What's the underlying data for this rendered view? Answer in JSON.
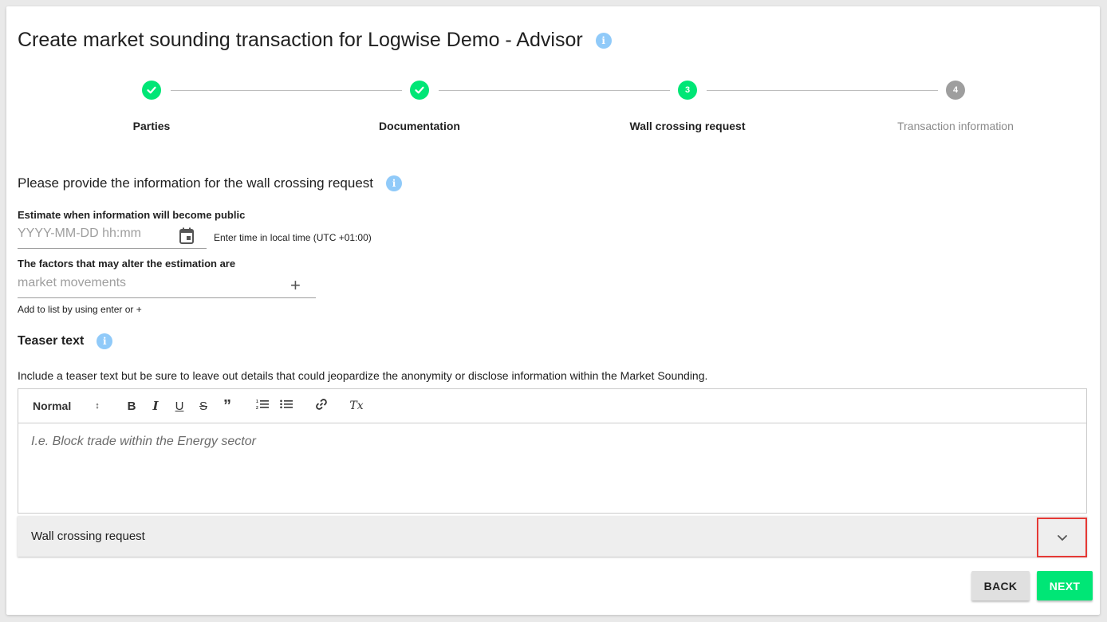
{
  "header": {
    "title": "Create market sounding transaction for Logwise Demo - Advisor",
    "info_icon": "info-icon"
  },
  "stepper": {
    "steps": [
      {
        "index": "1",
        "label": "Parties",
        "state": "done"
      },
      {
        "index": "2",
        "label": "Documentation",
        "state": "done"
      },
      {
        "index": "3",
        "label": "Wall crossing request",
        "state": "active"
      },
      {
        "index": "4",
        "label": "Transaction information",
        "state": "todo"
      }
    ]
  },
  "form": {
    "section_title": "Please provide the information for the wall crossing request",
    "estimate_label": "Estimate when information will become public",
    "estimate_placeholder": "YYYY-MM-DD hh:mm",
    "estimate_helper": "Enter time in local time (UTC +01:00)",
    "factors_label": "The factors that may alter the estimation are",
    "factors_placeholder": "market movements",
    "factors_add": "+",
    "factors_helper": "Add to list by using enter or +"
  },
  "teaser": {
    "title": "Teaser text",
    "description": "Include a teaser text but be sure to leave out details that could jeopardize the anonymity or disclose information within the Market Sounding.",
    "toolbar": {
      "format_select": "Normal",
      "format_arrows": "↕",
      "bold": "B",
      "italic": "I",
      "underline": "U",
      "strike": "S",
      "quote": "”",
      "ordered_list": "☰",
      "bullet_list": "☰",
      "link": "🔗",
      "clear": "Tx"
    },
    "placeholder": "I.e. Block trade within the Energy sector"
  },
  "accordion": {
    "label": "Wall crossing request",
    "toggle_icon": "chevron-down-icon"
  },
  "actions": {
    "back_label": "BACK",
    "next_label": "NEXT"
  },
  "colors": {
    "accent": "#00e676",
    "info": "#90caf9",
    "todo": "#9e9e9e",
    "highlight": "#e53935"
  }
}
